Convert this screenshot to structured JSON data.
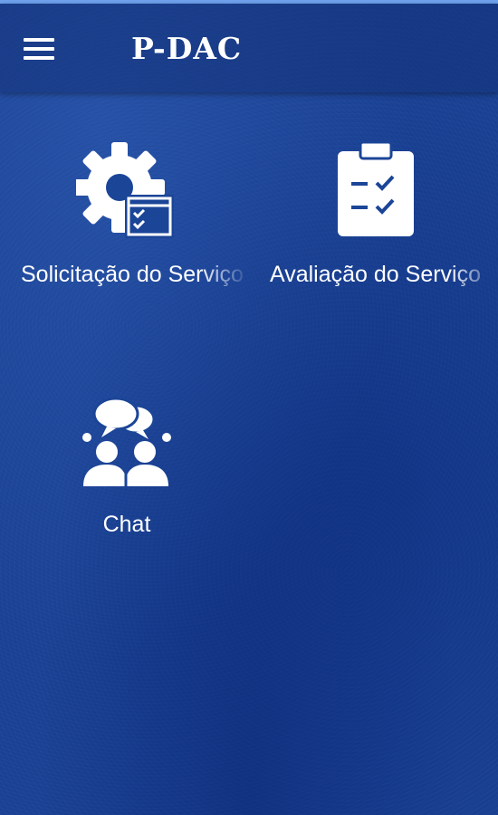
{
  "app_bar": {
    "title": "P-DAC",
    "menu_icon": "hamburger-menu-icon"
  },
  "tiles": [
    {
      "label": "Solicitação do Serviço",
      "icon": "gear-checklist-icon"
    },
    {
      "label": "Avaliação do Serviço",
      "icon": "clipboard-checklist-icon"
    },
    {
      "label": "Chat",
      "icon": "chat-people-icon"
    }
  ],
  "colors": {
    "background": "#1a4296",
    "top_strip": "#6fa3ee",
    "foreground": "#ffffff"
  }
}
